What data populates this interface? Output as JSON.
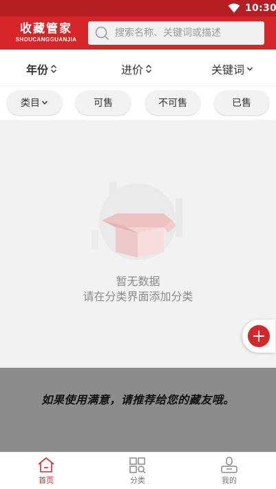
{
  "status_bar": {
    "time": "10:30",
    "icons": [
      "wifi-icon"
    ]
  },
  "header": {
    "logo_cn": "收藏管家",
    "logo_en": "SHOUCANGGUANJIA",
    "search_placeholder": "搜索名称、关键词或描述",
    "search_value": ""
  },
  "sort_bar": [
    {
      "label": "年份",
      "icon": "sort-updown-icon"
    },
    {
      "label": "进价",
      "icon": "sort-updown-icon"
    },
    {
      "label": "关键词",
      "icon": "chevron-down-icon"
    }
  ],
  "filters": [
    {
      "label": "类目",
      "icon": "chevron-down-icon"
    },
    {
      "label": "可售"
    },
    {
      "label": "不可售"
    },
    {
      "label": "已售"
    }
  ],
  "empty_state": {
    "title": "暂无数据",
    "hint": "请在分类界面添加分类"
  },
  "fab": {
    "icon": "plus-icon"
  },
  "banner": {
    "text": "如果使用满意，请推荐给您的藏友哦。"
  },
  "bottom_nav": [
    {
      "label": "首页",
      "icon": "home-icon",
      "active": true
    },
    {
      "label": "分类",
      "icon": "category-icon",
      "active": false
    },
    {
      "label": "我的",
      "icon": "profile-icon",
      "active": false
    }
  ],
  "colors": {
    "brand": "#d6262a",
    "status_bar": "#b51d22",
    "banner_bg": "#8c8c8c"
  }
}
